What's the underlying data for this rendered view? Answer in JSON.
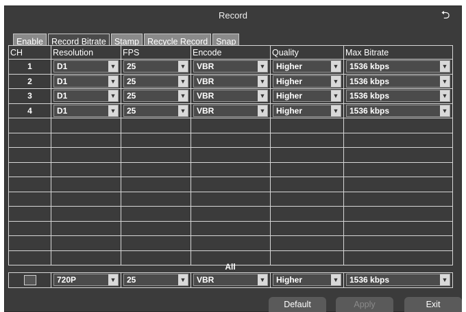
{
  "window": {
    "title": "Record"
  },
  "tabs": [
    {
      "label": "Enable"
    },
    {
      "label": "Record Bitrate"
    },
    {
      "label": "Stamp"
    },
    {
      "label": "Recycle Record"
    },
    {
      "label": "Snap"
    }
  ],
  "table": {
    "headers": [
      "CH",
      "Resolution",
      "FPS",
      "Encode",
      "Quality",
      "Max Bitrate"
    ],
    "rows": [
      {
        "ch": "1",
        "resolution": "D1",
        "fps": "25",
        "encode": "VBR",
        "quality": "Higher",
        "max_bitrate": "1536 kbps"
      },
      {
        "ch": "2",
        "resolution": "D1",
        "fps": "25",
        "encode": "VBR",
        "quality": "Higher",
        "max_bitrate": "1536 kbps"
      },
      {
        "ch": "3",
        "resolution": "D1",
        "fps": "25",
        "encode": "VBR",
        "quality": "Higher",
        "max_bitrate": "1536 kbps"
      },
      {
        "ch": "4",
        "resolution": "D1",
        "fps": "25",
        "encode": "VBR",
        "quality": "Higher",
        "max_bitrate": "1536 kbps"
      }
    ]
  },
  "all": {
    "label": "All",
    "resolution": "720P",
    "fps": "25",
    "encode": "VBR",
    "quality": "Higher",
    "max_bitrate": "1536 kbps"
  },
  "buttons": {
    "default": "Default",
    "apply": "Apply",
    "exit": "Exit"
  }
}
